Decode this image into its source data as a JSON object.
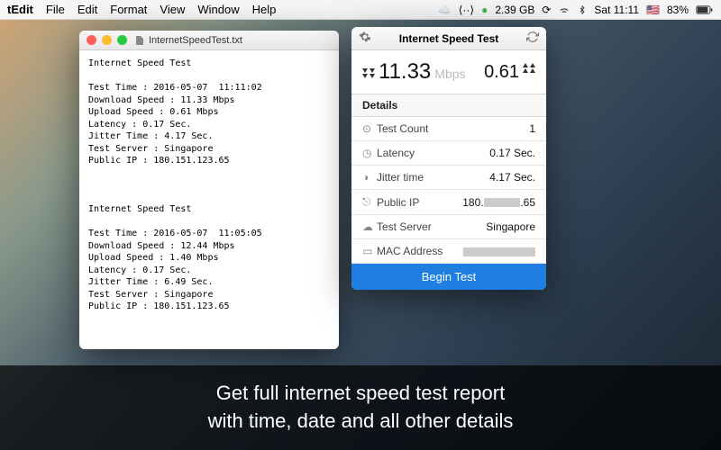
{
  "menubar": {
    "app": "tEdit",
    "items": [
      "File",
      "Edit",
      "Format",
      "View",
      "Window",
      "Help"
    ],
    "right": {
      "mem": "2.39 GB",
      "time": "Sat 11:11",
      "flag": "🇺🇸",
      "battery": "83%",
      "charging": "⚡"
    }
  },
  "textedit": {
    "filename": "InternetSpeedTest.txt",
    "body": "Internet Speed Test\n\nTest Time : 2016-05-07  11:11:02\nDownload Speed : 11.33 Mbps\nUpload Speed : 0.61 Mbps\nLatency : 0.17 Sec.\nJitter Time : 4.17 Sec.\nTest Server : Singapore\nPublic IP : 180.151.123.65\n\n\n\nInternet Speed Test\n\nTest Time : 2016-05-07  11:05:05\nDownload Speed : 12.44 Mbps\nUpload Speed : 1.40 Mbps\nLatency : 0.17 Sec.\nJitter Time : 6.49 Sec.\nTest Server : Singapore\nPublic IP : 180.151.123.65"
  },
  "speedapp": {
    "title": "Internet Speed Test",
    "download_value": "11.33",
    "download_unit": "Mbps",
    "upload_value": "0.61",
    "details_label": "Details",
    "rows": {
      "test_count": {
        "label": "Test Count",
        "value": "1"
      },
      "latency": {
        "label": "Latency",
        "value": "0.17 Sec."
      },
      "jitter": {
        "label": "Jitter time",
        "value": "4.17 Sec."
      },
      "public_ip": {
        "label": "Public IP",
        "prefix": "180.",
        "suffix": ".65"
      },
      "server": {
        "label": "Test Server",
        "value": "Singapore"
      },
      "mac": {
        "label": "MAC Address"
      }
    },
    "button": "Begin Test"
  },
  "caption": {
    "line1": "Get full internet speed test report",
    "line2": "with time, date and all other details"
  }
}
